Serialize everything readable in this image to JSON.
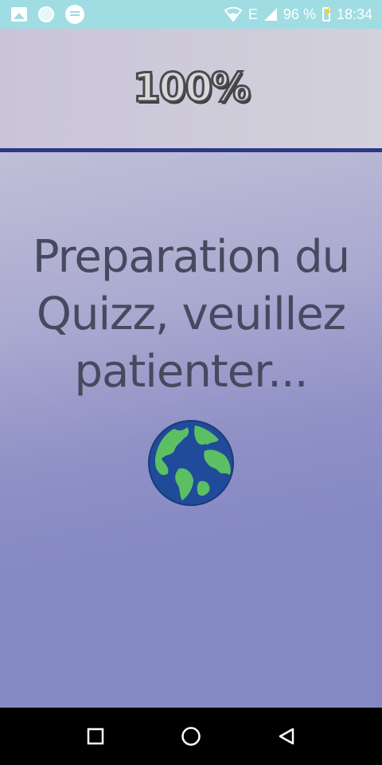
{
  "status_bar": {
    "icons_left": [
      "image-icon",
      "circle-icon",
      "message-icon"
    ],
    "network": "E",
    "battery_percent": "96 %",
    "time": "18:34"
  },
  "header": {
    "progress_label": "100%",
    "progress_value": 100
  },
  "main": {
    "loading_message": "Preparation du Quizz, veuillez patienter...",
    "image": "globe-icon"
  },
  "nav_bar": {
    "buttons": [
      "recents-square-icon",
      "home-circle-icon",
      "back-triangle-icon"
    ]
  },
  "colors": {
    "status_bar": "#9fdde3",
    "divider": "#2a3888",
    "background": "#8589c3",
    "text": "#454a5f",
    "globe_ocean": "#1f4b9a",
    "globe_land": "#5cbf63"
  }
}
